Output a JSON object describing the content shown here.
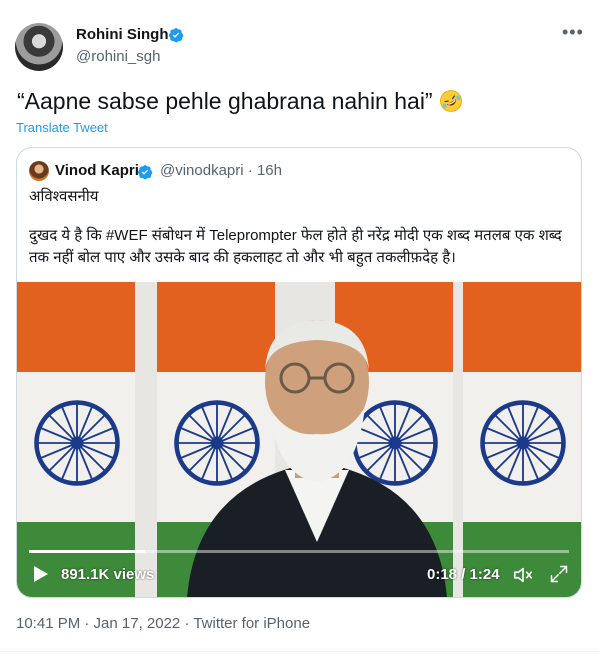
{
  "author": {
    "name": "Rohini Singh",
    "handle": "@rohini_sgh",
    "verified": true,
    "more_icon": "more-horizontal-icon"
  },
  "tweet": {
    "text": "“Aapne sabse pehle ghabrana nahin hai”",
    "emoji": "rolling-on-floor-laughing",
    "translate_label": "Translate Tweet"
  },
  "quoted": {
    "name": "Vinod Kapri",
    "handle": "@vinodkapri",
    "separator": "·",
    "age": "16h",
    "verified": true,
    "line1": "अविश्वसनीय",
    "line2": "दुखद ये है कि #WEF संबोधन में Teleprompter फेल होते ही नरेंद्र मोदी एक शब्द मतलब एक शब्द तक नहीं बोल पाए और उसके बाद की हकलाहट तो और भी बहुत तकलीफ़देह है।",
    "video": {
      "views": "891.1K views",
      "time": "0:18 / 1:24",
      "progress": 0.214
    }
  },
  "footer": {
    "meta": "10:41 PM · Jan 17, 2022 · Twitter for iPhone"
  },
  "colors": {
    "accent": "#1d9bf0",
    "muted": "#536471",
    "saffron": "#e2611f",
    "green": "#3c8a3a",
    "chakra": "#1c3a8a"
  }
}
